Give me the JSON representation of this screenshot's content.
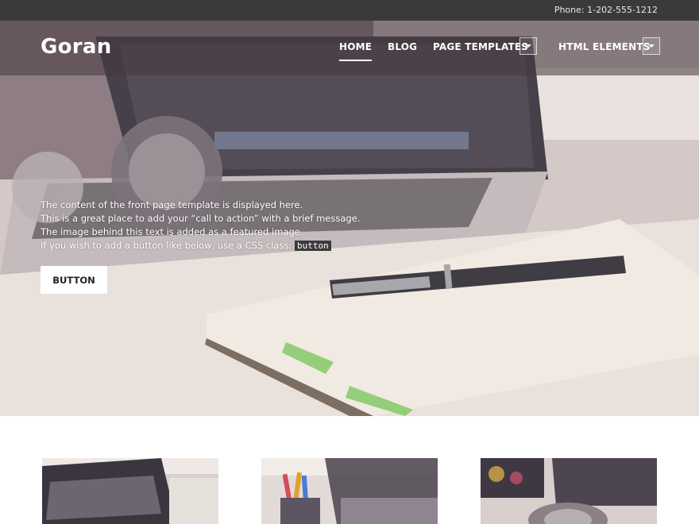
{
  "topbar": {
    "phone": "Phone: 1-202-555-1212"
  },
  "header": {
    "logo": "Goran",
    "nav": [
      {
        "label": "HOME",
        "active": true
      },
      {
        "label": "BLOG"
      },
      {
        "label": "PAGE TEMPLATES",
        "dropdown_icon": "chevron-down-icon"
      },
      {
        "label": "HTML ELEMENTS",
        "dropdown_icon": "chevron-down-icon"
      }
    ]
  },
  "hero": {
    "lines": [
      "The content of the front page template is displayed here.",
      "This is a great place to add your “call to action” with a brief message.",
      "The image behind this text is added as a featured image.",
      "If you wish to add a button like below, use a CSS class: "
    ],
    "code_snippet": "button",
    "button_label": "BUTTON"
  },
  "colors": {
    "topbar": "#3a3a3a",
    "accent": "#ffffff"
  }
}
